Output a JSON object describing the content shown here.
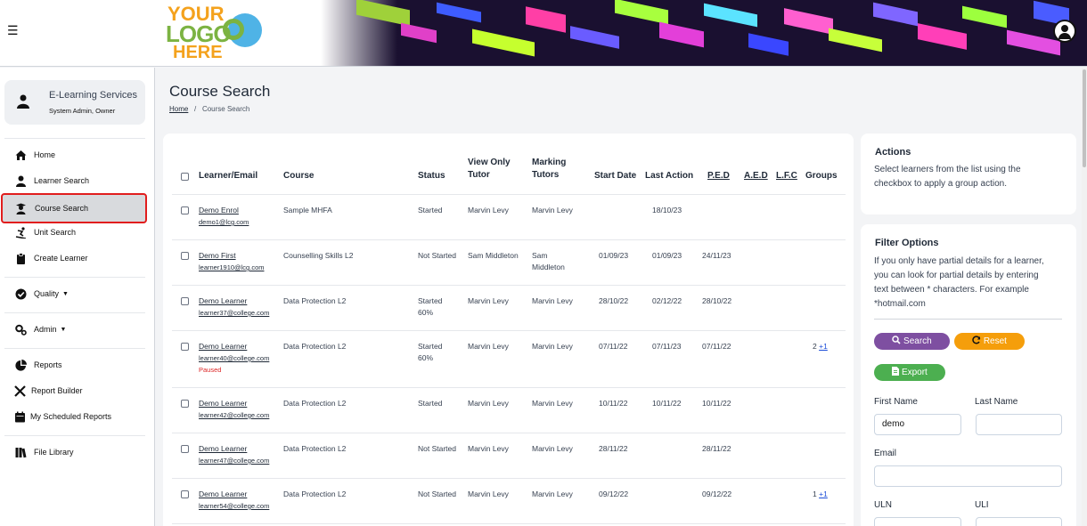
{
  "header": {
    "menu_icon": "hamburger-icon",
    "logo_text": [
      "YOUR",
      "LOGO",
      "HERE"
    ],
    "user_icon": "user-circle-icon"
  },
  "sidebar": {
    "service": {
      "name": "E-Learning Services",
      "role": "System Admin, Owner",
      "icon": "user-icon"
    },
    "items": [
      {
        "label": "Home",
        "icon": "home-icon"
      },
      {
        "label": "Learner Search",
        "icon": "user-icon"
      },
      {
        "label": "Course Search",
        "icon": "graduate-icon",
        "active": true
      },
      {
        "label": "Unit Search",
        "icon": "skier-icon"
      },
      {
        "label": "Create Learner",
        "icon": "clipboard-icon"
      },
      {
        "label": "Quality",
        "icon": "check-circle-icon"
      },
      {
        "label": "Admin",
        "icon": "cogs-icon"
      },
      {
        "label": "Reports",
        "icon": "pie-chart-icon"
      },
      {
        "label": "Report Builder",
        "icon": "tools-icon"
      },
      {
        "label": "My Scheduled Reports",
        "icon": "calendar-icon"
      },
      {
        "label": "File Library",
        "icon": "books-icon"
      }
    ]
  },
  "page": {
    "title": "Course Search",
    "breadcrumb": {
      "home": "Home",
      "sep": "/",
      "current": "Course Search"
    }
  },
  "table": {
    "headers": {
      "learner": "Learner/Email",
      "course": "Course",
      "status": "Status",
      "view_only_tutor_1": "View Only",
      "view_only_tutor_2": "Tutor",
      "marking_tutors_1": "Marking",
      "marking_tutors_2": "Tutors",
      "start_date": "Start Date",
      "last_action": "Last Action",
      "ped": "P.E.D",
      "aed": "A.E.D",
      "lfc": "L.F.C",
      "groups": "Groups"
    },
    "rows": [
      {
        "name": "Demo Enrol",
        "email": "demo1@lcg.com",
        "course": "Sample MHFA",
        "status": "Started",
        "status2": "",
        "view_tutor": "Marvin Levy",
        "marking": "Marvin Levy",
        "marking2": "",
        "start": "",
        "last": "18/10/23",
        "ped": "",
        "groups": "",
        "groups_plus": "",
        "note": ""
      },
      {
        "name": "Demo First",
        "email": "learner1910@lcg.com",
        "course": "Counselling Skills L2",
        "status": "Not Started",
        "status2": "",
        "view_tutor": "Sam Middleton",
        "marking": "Sam",
        "marking2": "Middleton",
        "start": "01/09/23",
        "last": "01/09/23",
        "ped": "24/11/23",
        "groups": "",
        "groups_plus": "",
        "note": ""
      },
      {
        "name": "Demo Learner",
        "email": "learner37@college.com",
        "course": "Data Protection L2",
        "status": "Started",
        "status2": "60%",
        "view_tutor": "Marvin Levy",
        "marking": "Marvin Levy",
        "marking2": "",
        "start": "28/10/22",
        "last": "02/12/22",
        "ped": "28/10/22",
        "groups": "",
        "groups_plus": "",
        "note": ""
      },
      {
        "name": "Demo Learner",
        "email": "learner40@college.com",
        "course": "Data Protection L2",
        "status": "Started",
        "status2": "60%",
        "view_tutor": "Marvin Levy",
        "marking": "Marvin Levy",
        "marking2": "",
        "start": "07/11/22",
        "last": "07/11/23",
        "ped": "07/11/22",
        "groups": "2",
        "groups_plus": "+1",
        "note": "Paused"
      },
      {
        "name": "Demo Learner",
        "email": "learner42@college.com",
        "course": "Data Protection L2",
        "status": "Started",
        "status2": "",
        "view_tutor": "Marvin Levy",
        "marking": "Marvin Levy",
        "marking2": "",
        "start": "10/11/22",
        "last": "10/11/22",
        "ped": "10/11/22",
        "groups": "",
        "groups_plus": "",
        "note": ""
      },
      {
        "name": "Demo Learner",
        "email": "learner47@college.com",
        "course": "Data Protection L2",
        "status": "Not Started",
        "status2": "",
        "view_tutor": "Marvin Levy",
        "marking": "Marvin Levy",
        "marking2": "",
        "start": "28/11/22",
        "last": "",
        "ped": "28/11/22",
        "groups": "",
        "groups_plus": "",
        "note": ""
      },
      {
        "name": "Demo Learner",
        "email": "learner54@college.com",
        "course": "Data Protection L2",
        "status": "Not Started",
        "status2": "",
        "view_tutor": "Marvin Levy",
        "marking": "Marvin Levy",
        "marking2": "",
        "start": "09/12/22",
        "last": "",
        "ped": "09/12/22",
        "groups": "1",
        "groups_plus": "+1",
        "note": ""
      }
    ]
  },
  "actions": {
    "title": "Actions",
    "desc1": "Select learners from the list using the",
    "desc2": "checkbox to apply a group action."
  },
  "filter": {
    "title": "Filter Options",
    "desc": [
      "If you only have partial details for a learner,",
      "you can look for partial details by entering",
      "text between * characters. For example",
      "*hotmail.com"
    ],
    "search_label": "Search",
    "reset_label": "Reset",
    "export_label": "Export",
    "first_name_label": "First Name",
    "first_name_value": "demo",
    "last_name_label": "Last Name",
    "last_name_value": "",
    "email_label": "Email",
    "email_value": "",
    "uln_label": "ULN",
    "uli_label": "ULI",
    "colors": {
      "search": "#7e4fa1",
      "reset": "#f59e0b",
      "export": "#4caf50"
    }
  }
}
